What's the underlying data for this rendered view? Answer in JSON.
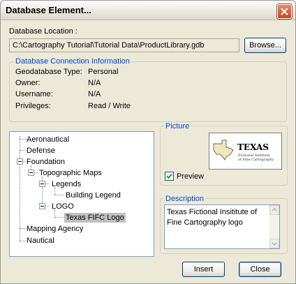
{
  "window": {
    "title": "Database Element..."
  },
  "location": {
    "label": "Database Location :",
    "path": "C:\\Cartography Tutorial\\Tutorial Data\\ProductLibrary.gdb",
    "browse_label": "Browse..."
  },
  "connection": {
    "title": "Database Connection Information",
    "rows": [
      {
        "key": "Geodatabase Type:",
        "value": "Personal"
      },
      {
        "key": "Owner:",
        "value": "N/A"
      },
      {
        "key": "Username:",
        "value": "N/A"
      },
      {
        "key": "Privileges:",
        "value": "Read / Write"
      }
    ]
  },
  "tree": {
    "items": [
      {
        "label": "Aeronautical"
      },
      {
        "label": "Defense"
      },
      {
        "label": "Foundation"
      },
      {
        "label": "Topographic Maps"
      },
      {
        "label": "Legends"
      },
      {
        "label": "Building Legend"
      },
      {
        "label": "LOGO"
      },
      {
        "label": "Texas FIFC Logo",
        "selected": true
      },
      {
        "label": "Mapping Agency"
      },
      {
        "label": "Nautical"
      }
    ]
  },
  "picture": {
    "title": "Picture",
    "preview_label": "Preview",
    "preview_checked": true,
    "logo": {
      "heading": "TEXAS",
      "line1": "Fictional Institute",
      "line2": "of Fine Cartography"
    }
  },
  "description": {
    "title": "Description",
    "text": "Texas Fictional Insititute of Fine Cartography logo"
  },
  "buttons": {
    "insert_label": "Insert",
    "close_label": "Close"
  },
  "colors": {
    "group_title": "#0046d5",
    "selection": "#c0c0c0",
    "checkmark": "#21a121"
  }
}
